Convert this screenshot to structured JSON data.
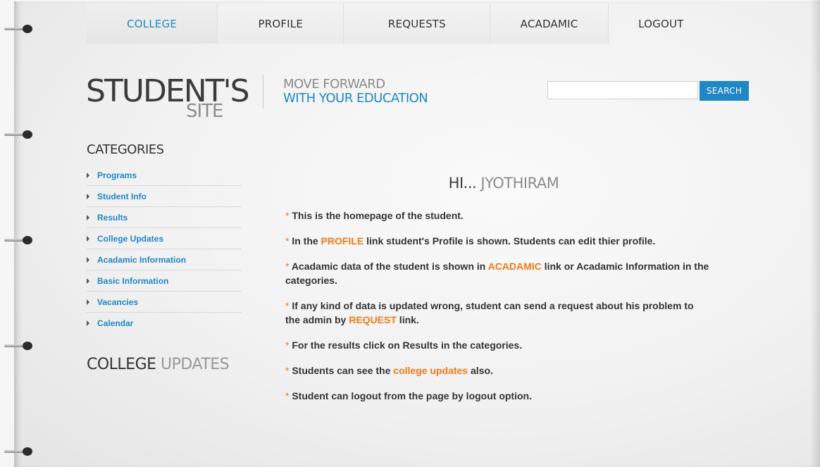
{
  "nav": {
    "items": [
      {
        "label": "COLLEGE"
      },
      {
        "label": "PROFILE"
      },
      {
        "label": "REQUESTS"
      },
      {
        "label": "ACADAMIC"
      },
      {
        "label": "LOGOUT"
      }
    ],
    "active": "COLLEGE"
  },
  "logo": {
    "main": "STUDENT'S",
    "sub": "SITE"
  },
  "tagline": {
    "line1": "MOVE FORWARD",
    "line2": "WITH YOUR EDUCATION"
  },
  "search": {
    "value": "",
    "button_label": "SEARCH"
  },
  "sidebar": {
    "categories_title": "CATEGORIES",
    "items": [
      {
        "label": "Programs"
      },
      {
        "label": "Student Info"
      },
      {
        "label": "Results"
      },
      {
        "label": "College Updates"
      },
      {
        "label": "Acadamic Information"
      },
      {
        "label": "Basic Information"
      },
      {
        "label": "Vacancies"
      },
      {
        "label": "Calendar"
      }
    ],
    "updates_title_dark": "COLLEGE",
    "updates_title_light": "UPDATES"
  },
  "main": {
    "greeting_prefix": "HI...",
    "greeting_name": "JYOTHIRAM",
    "bullet": "*",
    "line1": " This is the homepage of the student.",
    "line2_a": " In the ",
    "line2_link": "PROFILE",
    "line2_b": " link student's Profile is shown. Students can edit thier profile.",
    "line3_a": " Acadamic data of the student is shown in ",
    "line3_link": "ACADAMIC",
    "line3_b": " link or Acadamic Information in the",
    "line3_c": " categories.",
    "line4_a": " If any kind of data is updated wrong, student can send a request about his problem to",
    "line4_b": "the admin by ",
    "line4_link": "REQUEST",
    "line4_c": " link.",
    "line5": " For the results click on Results in the categories.",
    "line6_a": " Students can see the ",
    "line6_link": "college updates",
    "line6_b": " also.",
    "line7": " Student can logout from the page by logout option."
  },
  "colors": {
    "accent": "#1f87c6",
    "highlight": "#f07a1a",
    "text": "#333333"
  }
}
